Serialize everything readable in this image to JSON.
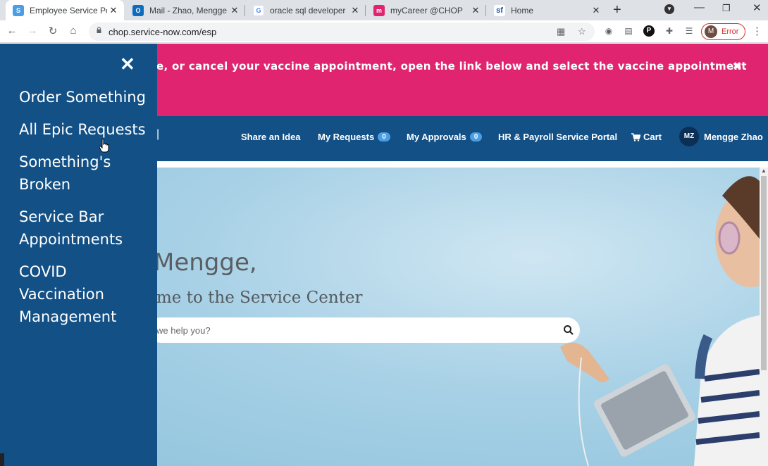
{
  "browser": {
    "tabs": [
      {
        "title": "Employee Service Portal",
        "favicon": "servicenow-icon",
        "color": "#4a9ee5",
        "glyph": "S",
        "active": true
      },
      {
        "title": "Mail - Zhao, Mengge - O",
        "favicon": "outlook-icon",
        "color": "#0f6cbd",
        "glyph": "O",
        "active": false
      },
      {
        "title": "oracle sql developer do",
        "favicon": "google-icon",
        "color": "#ffffff",
        "glyph": "G",
        "active": false
      },
      {
        "title": "myCareer @CHOP",
        "favicon": "mycareer-icon",
        "color": "#e0246f",
        "glyph": "m",
        "active": false
      },
      {
        "title": "Home",
        "favicon": "successfactors-icon",
        "color": "#ffffff",
        "glyph": "sf",
        "active": false
      }
    ],
    "url": "chop.service-now.com/esp",
    "profile_initial": "M",
    "profile_status": "Error"
  },
  "banner": {
    "text": "e, or cancel your vaccine appointment, open the link below and select the vaccine appointment",
    "color": "#e0246f"
  },
  "header": {
    "fragment": "|",
    "nav": [
      {
        "label": "Share an Idea"
      },
      {
        "label": "My Requests",
        "badge": "0"
      },
      {
        "label": "My Approvals",
        "badge": "0"
      },
      {
        "label": "HR & Payroll Service Portal"
      },
      {
        "label": "Cart",
        "icon": "cart-icon"
      }
    ],
    "user_initials": "MZ",
    "user_name": "Mengge Zhao",
    "color": "#135086"
  },
  "hero": {
    "greeting": "Mengge,",
    "welcome": "me to the Service Center",
    "search_placeholder": "we help you?"
  },
  "sidemenu": {
    "items": [
      {
        "label": "Order Something"
      },
      {
        "label": "All Epic Requests"
      },
      {
        "label": "Something's Broken"
      },
      {
        "label": "Service Bar Appointments"
      },
      {
        "label": "COVID Vaccination Management"
      }
    ]
  }
}
